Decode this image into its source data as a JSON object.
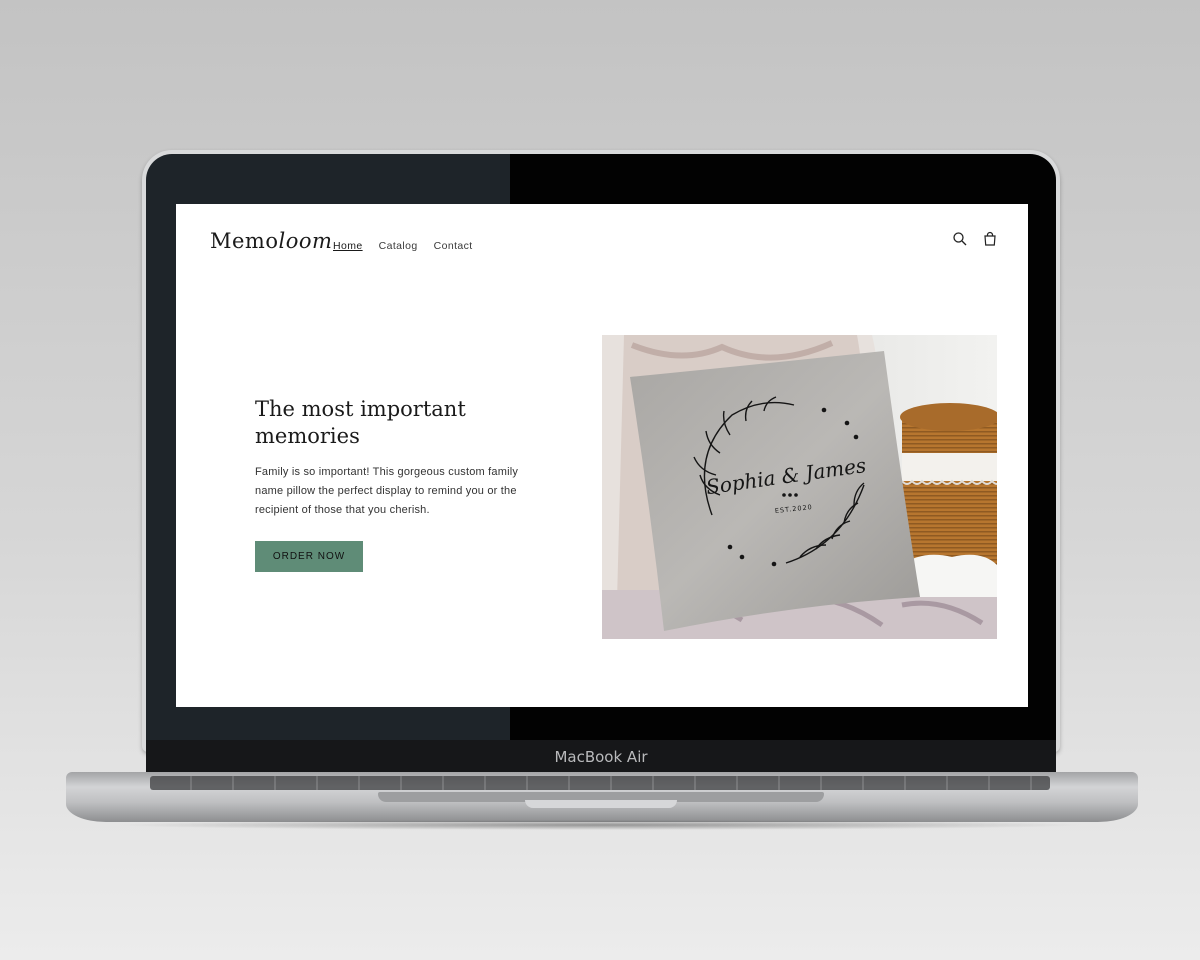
{
  "device": {
    "label": "MacBook Air"
  },
  "site": {
    "logo": {
      "main": "Memo",
      "script": "loom"
    },
    "nav": [
      {
        "label": "Home",
        "active": true
      },
      {
        "label": "Catalog",
        "active": false
      },
      {
        "label": "Contact",
        "active": false
      }
    ],
    "icons": {
      "search": "search-icon",
      "cart": "cart-icon"
    },
    "hero": {
      "title": "The most important memories",
      "body": "Family is so important! This gorgeous custom family name pillow the perfect display to remind you or the recipient of those that you cherish.",
      "cta_label": "ORDER NOW",
      "image": {
        "pillow_names": "Sophia & James",
        "pillow_est": "EST.2020"
      }
    },
    "colors": {
      "accent": "#5f8c77"
    }
  }
}
